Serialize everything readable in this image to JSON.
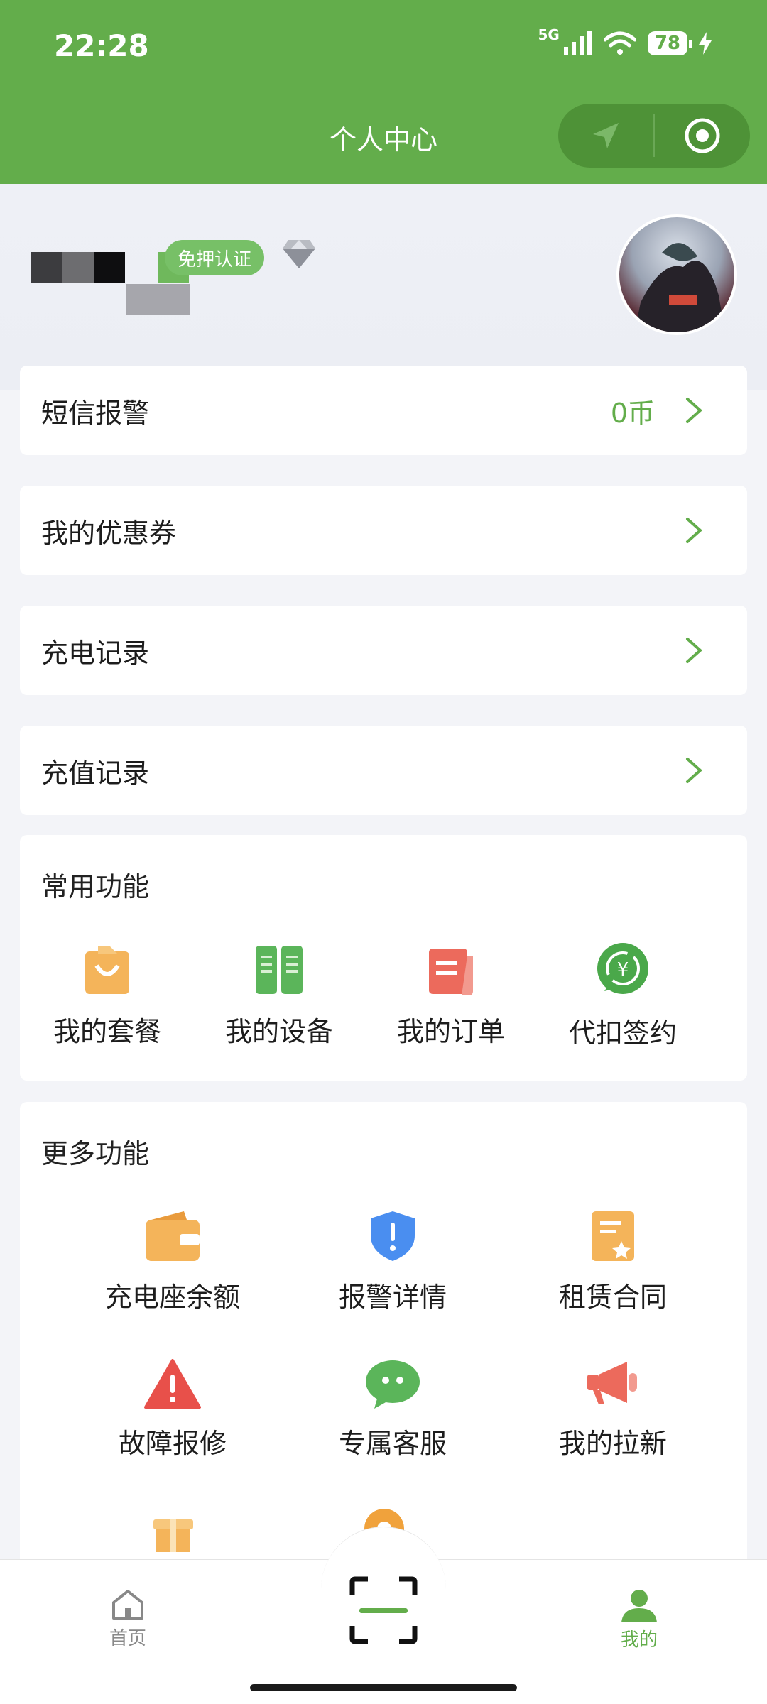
{
  "status_bar": {
    "time": "22:28",
    "network": "5G",
    "battery": "78"
  },
  "header": {
    "title": "个人中心"
  },
  "profile": {
    "badge": "免押认证"
  },
  "rows": [
    {
      "label": "短信报警",
      "value": "0币"
    },
    {
      "label": "我的优惠券",
      "value": ""
    },
    {
      "label": "充电记录",
      "value": ""
    },
    {
      "label": "充值记录",
      "value": ""
    }
  ],
  "common": {
    "title": "常用功能",
    "items": [
      {
        "label": "我的套餐",
        "icon": "package-icon"
      },
      {
        "label": "我的设备",
        "icon": "device-icon"
      },
      {
        "label": "我的订单",
        "icon": "order-icon"
      },
      {
        "label": "代扣签约",
        "icon": "auto-pay-icon"
      }
    ]
  },
  "more": {
    "title": "更多功能",
    "items": [
      {
        "label": "充电座余额",
        "icon": "wallet-icon"
      },
      {
        "label": "报警详情",
        "icon": "shield-alert-icon"
      },
      {
        "label": "租赁合同",
        "icon": "contract-icon"
      },
      {
        "label": "故障报修",
        "icon": "warning-icon"
      },
      {
        "label": "专属客服",
        "icon": "chat-icon"
      },
      {
        "label": "我的拉新",
        "icon": "megaphone-icon"
      }
    ]
  },
  "tabbar": {
    "home": "首页",
    "mine": "我的"
  },
  "colors": {
    "brand": "#63ad4b",
    "capsule": "#4e9237"
  }
}
